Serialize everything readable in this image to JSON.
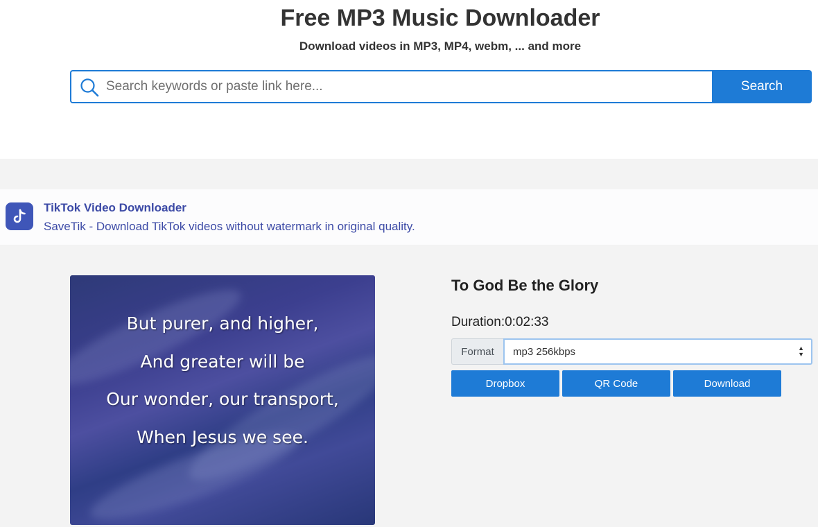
{
  "header": {
    "title": "Free MP3 Music Downloader",
    "subtitle": "Download videos in MP3, MP4, webm, ... and more"
  },
  "search": {
    "placeholder": "Search keywords or paste link here...",
    "value": "",
    "button_label": "Search"
  },
  "ad": {
    "title": "TikTok Video Downloader",
    "description": "SaveTik - Download TikTok videos without watermark in original quality.",
    "logo_icon": "tiktok-icon"
  },
  "result": {
    "thumbnail_lines": [
      "But purer, and higher,",
      "And greater will be",
      "Our wonder, our transport,",
      "When Jesus we see."
    ],
    "title": "To God Be the Glory",
    "duration": "Duration:0:02:33",
    "format_label": "Format",
    "format_selected": "mp3 256kbps",
    "buttons": {
      "dropbox": "Dropbox",
      "qr_code": "QR Code",
      "download": "Download"
    }
  },
  "colors": {
    "accent": "#1e7bd6",
    "ad_link": "#3c4aa6",
    "band": "#f3f3f3"
  }
}
